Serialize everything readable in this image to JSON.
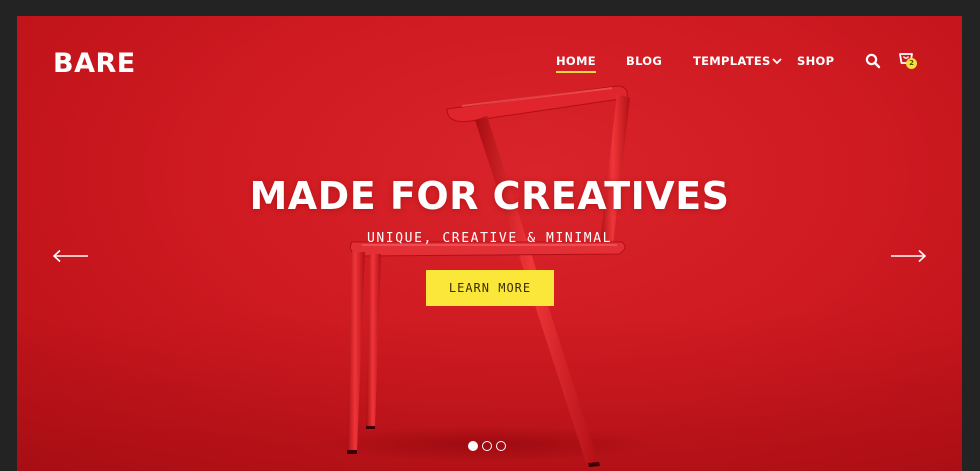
{
  "brand": {
    "logo_text": "BARE"
  },
  "nav": {
    "items": [
      {
        "label": "HOME",
        "active": true
      },
      {
        "label": "BLOG",
        "active": false
      },
      {
        "label": "TEMPLATES",
        "active": false,
        "has_dropdown": true
      },
      {
        "label": "SHOP",
        "active": false
      }
    ],
    "search_icon": "search-icon",
    "cart_icon": "cart-icon",
    "cart_count": "2"
  },
  "hero": {
    "title": "MADE FOR CREATIVES",
    "subtitle": "UNIQUE, CREATIVE & MINIMAL",
    "cta_label": "LEARN MORE",
    "prev_icon": "arrow-left-icon",
    "next_icon": "arrow-right-icon",
    "slides_total": 3,
    "active_slide": 1
  },
  "colors": {
    "hero_background": "#cf1a21",
    "accent_yellow": "#fbe73a",
    "text_white": "#ffffff",
    "page_frame": "#232323"
  }
}
